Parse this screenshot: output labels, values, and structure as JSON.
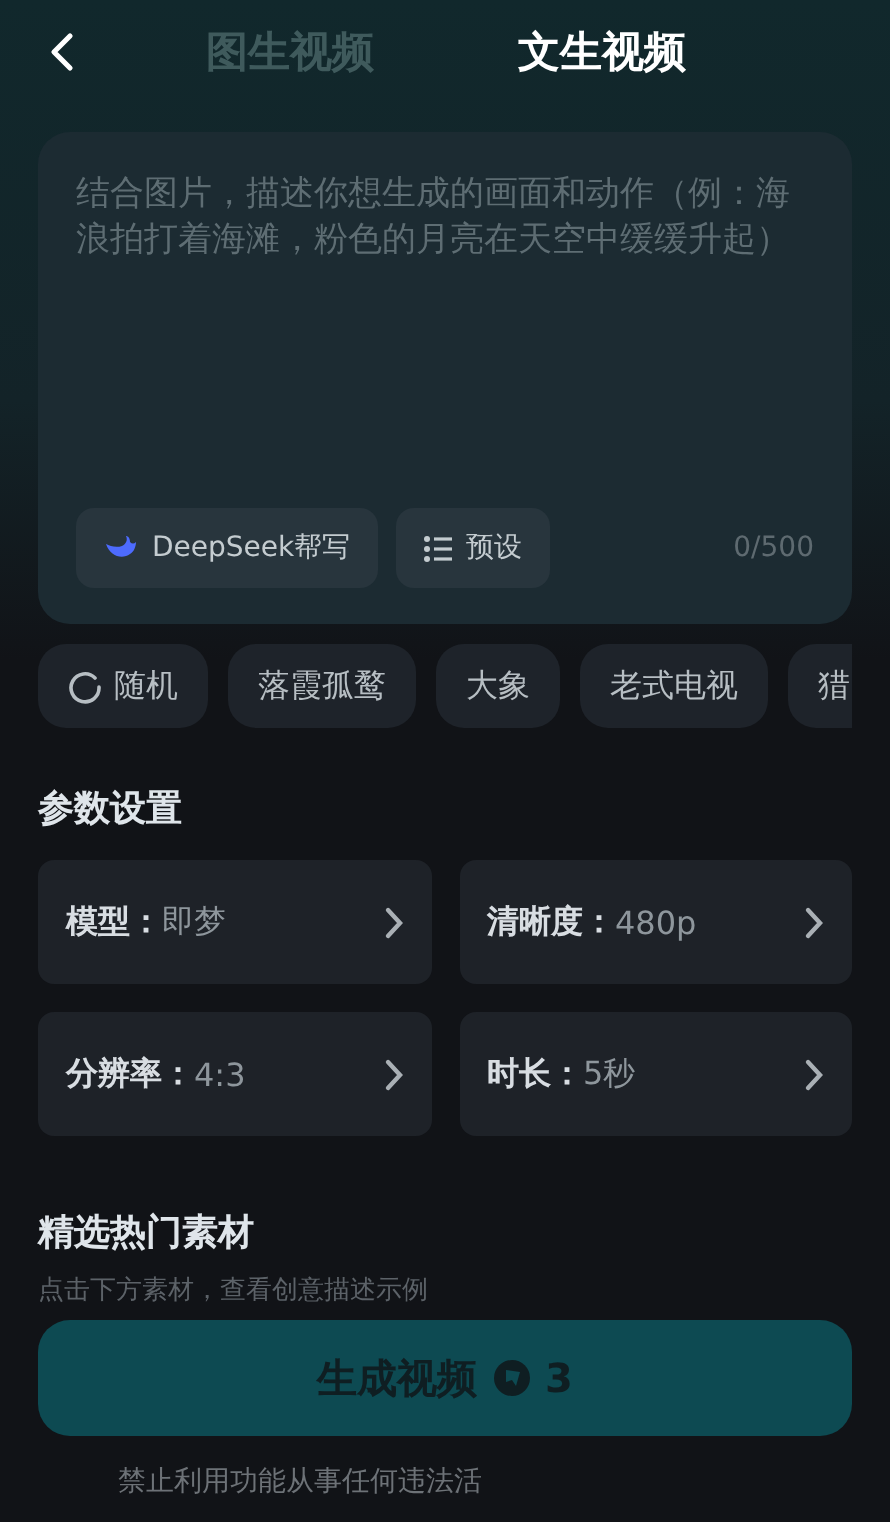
{
  "tabs": [
    {
      "label": "图生视频",
      "selected": false
    },
    {
      "label": "文生视频",
      "selected": true
    }
  ],
  "prompt": {
    "placeholder": "结合图片，描述你想生成的画面和动作（例：海浪拍打着海滩，粉色的月亮在天空中缓缓升起）",
    "assist_button": "DeepSeek帮写",
    "preset_button": "预设",
    "counter": "0/500"
  },
  "chips": [
    {
      "label": "随机",
      "kind": "random"
    },
    {
      "label": "落霞孤鹜",
      "kind": "text"
    },
    {
      "label": "大象",
      "kind": "text"
    },
    {
      "label": "老式电视",
      "kind": "text"
    },
    {
      "label": "猎",
      "kind": "text"
    }
  ],
  "settings": {
    "title": "参数设置",
    "items": [
      {
        "label": "模型：",
        "value": "即梦"
      },
      {
        "label": "清晰度：",
        "value": "480p"
      },
      {
        "label": "分辨率：",
        "value": "4:3"
      },
      {
        "label": "时长：",
        "value": "5秒"
      }
    ]
  },
  "materials": {
    "title": "精选热门素材",
    "subtitle": "点击下方素材，查看创意描述示例"
  },
  "generate_button": {
    "label": "生成视频",
    "cost": "3"
  },
  "disclaimer": "禁止利用功能从事任何违法活"
}
